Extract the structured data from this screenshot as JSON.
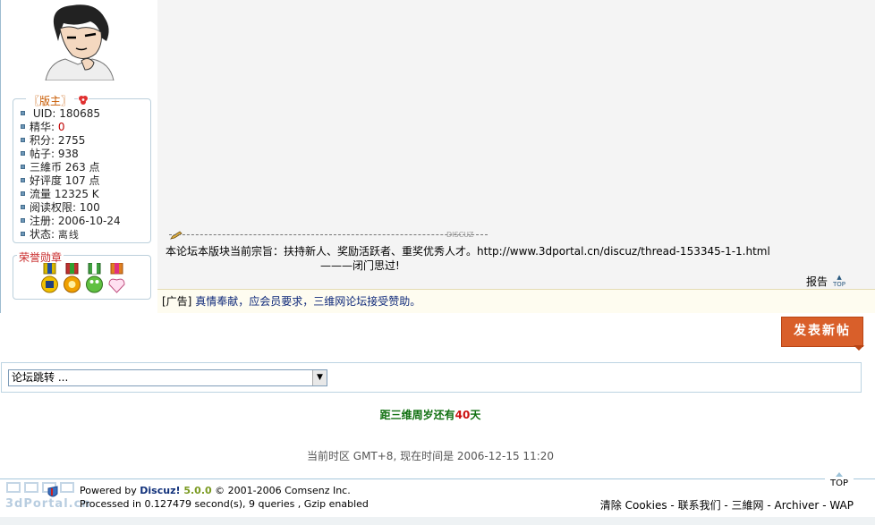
{
  "user": {
    "role": "〖版主〗",
    "stats": [
      {
        "label": " UID: 180685"
      },
      {
        "label": "精华: ",
        "value": "0"
      },
      {
        "label": "积分: 2755"
      },
      {
        "label": "帖子: 938"
      },
      {
        "label": "三維币 263 点"
      },
      {
        "label": "好评度 107 点"
      },
      {
        "label": "流量 12325 K"
      },
      {
        "label": "阅读权限: 100"
      },
      {
        "label": "注册: 2006-10-24"
      },
      {
        "label": "状态: ",
        "value": "离线"
      }
    ],
    "honor_title": "荣誉勋章"
  },
  "post": {
    "sig_tag": "DISCUZ",
    "sig_line1": "本论坛本版块当前宗旨：扶持新人、奖励活跃者、重奖优秀人才。http://www.3dportal.cn/discuz/thread-153345-1-1.html",
    "sig_line2": "———闭门思过!",
    "report": "报告",
    "top_small": "TOP"
  },
  "ad": {
    "prefix": "[广告]",
    "text": "真情奉献，应会员要求，三维网论坛接受赞助。"
  },
  "new_post_button": "发表新帖",
  "forum_jump": {
    "selected": "论坛跳转 ...",
    "arrow": "▼"
  },
  "countdown": {
    "before": "距三维周岁还有",
    "number": "40",
    "after": "天"
  },
  "timezone": "当前时区 GMT+8, 现在时间是 2006-12-15 11:20",
  "footer": {
    "top": "TOP",
    "logo_text": "3dPortal.cn",
    "powered_prefix": "Powered by ",
    "brand": "Discuz!",
    "version": " 5.0.0",
    "copyright": "  © 2001-2006 Comsenz Inc.",
    "processed": "Processed in 0.127479 second(s), 9 queries , Gzip enabled",
    "links": [
      "清除 Cookies",
      "联系我们",
      "三維网",
      "Archiver",
      "WAP"
    ],
    "separator": " - "
  },
  "colors": {
    "border": "#9dbcd0",
    "new_post_bg": "#d95f2a",
    "countdown_green": "#107010",
    "countdown_red": "#cc1010",
    "link_blue": "#102a7a"
  }
}
